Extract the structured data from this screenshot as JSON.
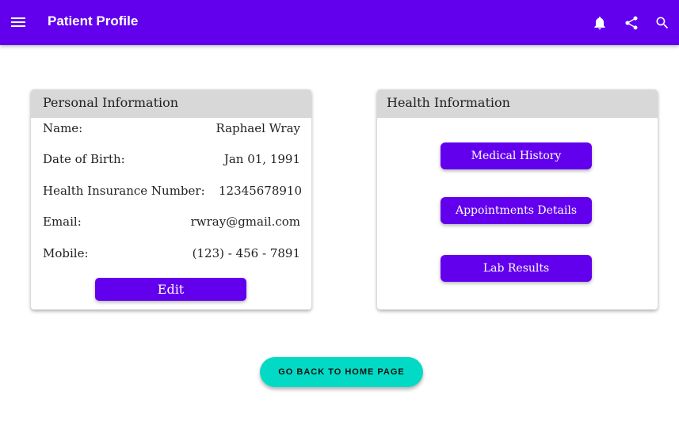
{
  "app_bar": {
    "title": "Patient Profile",
    "icons": [
      "menu-icon",
      "bell-icon",
      "share-icon",
      "search-icon"
    ],
    "color": "#6200ee"
  },
  "personal": {
    "header": "Personal Information",
    "rows": [
      {
        "label": "Name:",
        "value": "Raphael Wray"
      },
      {
        "label": "Date of Birth:",
        "value": "Jan 01, 1991"
      },
      {
        "label": "Health Insurance Number:",
        "value": "12345678910"
      },
      {
        "label": "Email:",
        "value": "rwray@gmail.com"
      },
      {
        "label": "Mobile:",
        "value": "(123) - 456 - 7891"
      }
    ],
    "edit_label": "Edit"
  },
  "health": {
    "header": "Health Information",
    "buttons": [
      "Medical History",
      "Appointments Details",
      "Lab Results"
    ]
  },
  "back_label": "GO BACK TO HOME PAGE",
  "colors": {
    "primary": "#6200ee",
    "secondary": "#03dac5",
    "header_bg": "#d8d8d8"
  }
}
